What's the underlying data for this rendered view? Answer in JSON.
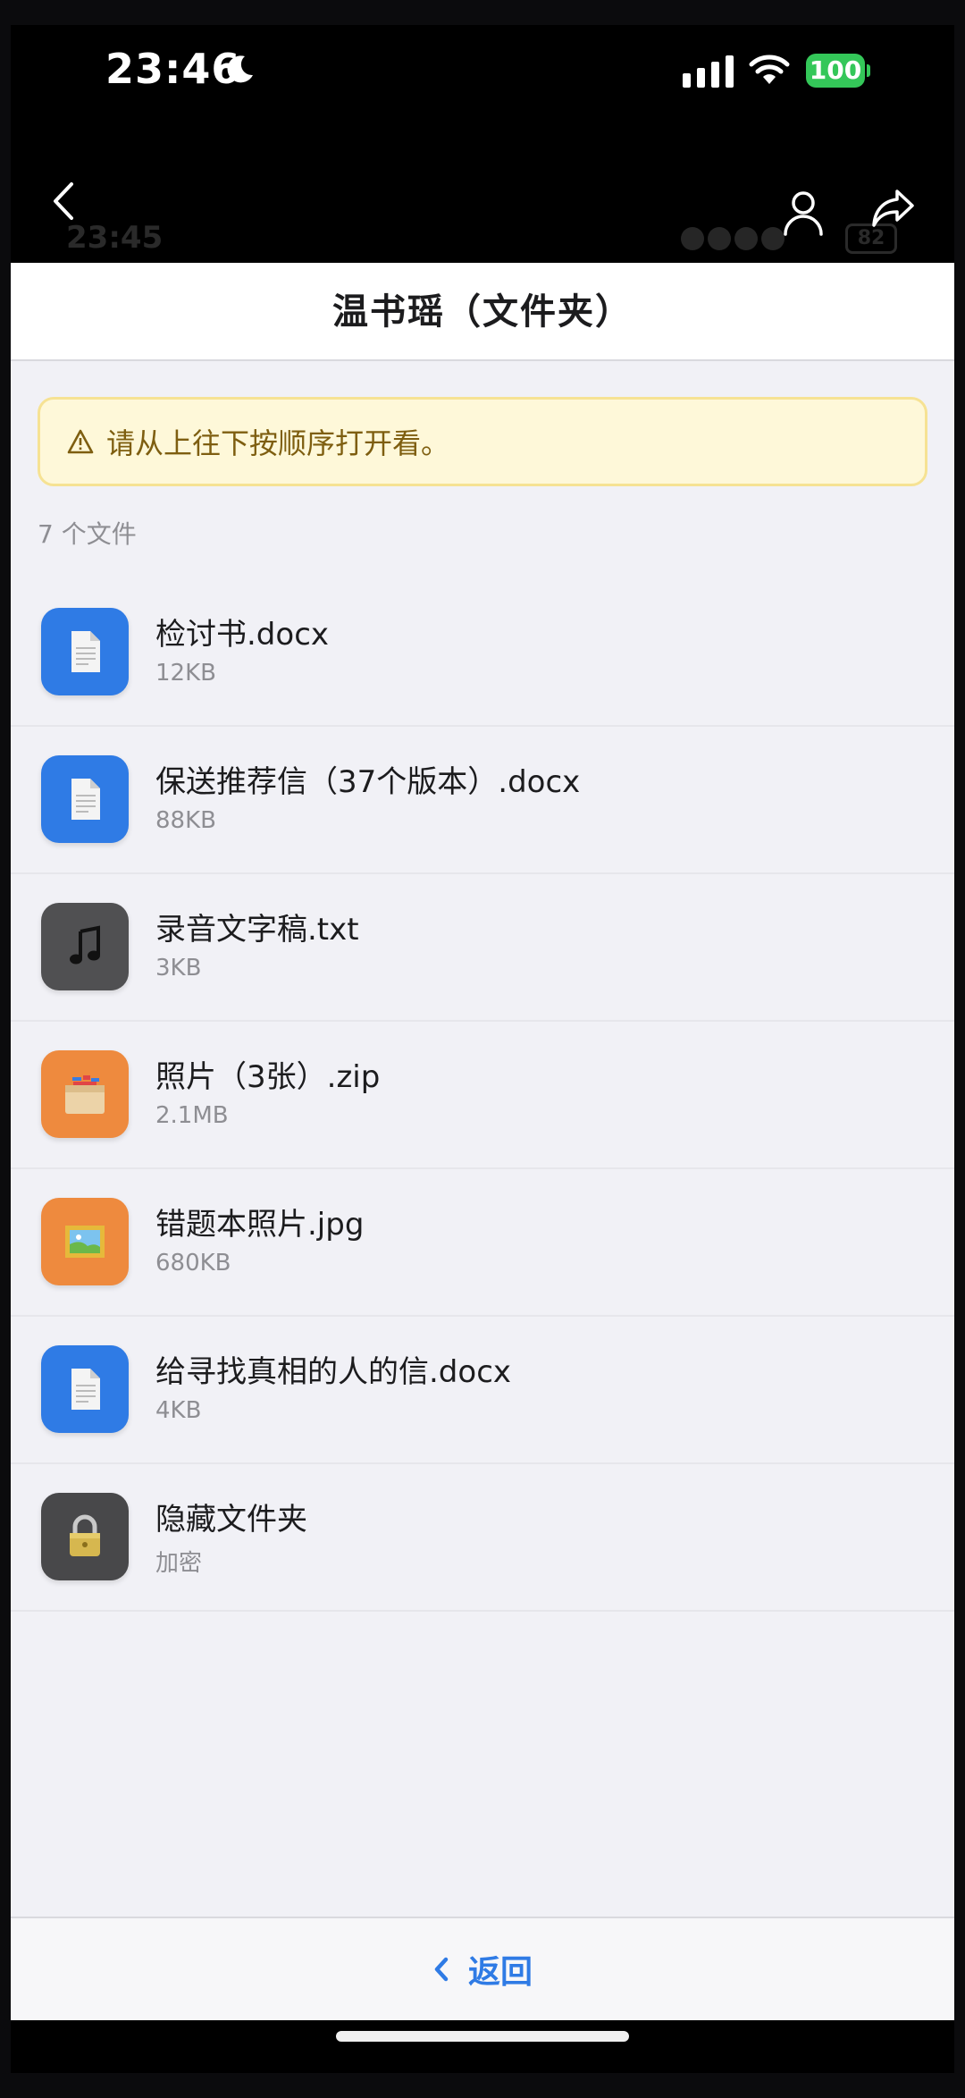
{
  "status_bar": {
    "time": "23:46",
    "battery": "100"
  },
  "ghost_status": {
    "time": "23:45",
    "battery": "82"
  },
  "header": {
    "title": "温书瑶（文件夹）"
  },
  "notice": {
    "text": "请从上往下按顺序打开看。"
  },
  "file_count": "7 个文件",
  "files": [
    {
      "name": "检讨书.docx",
      "meta": "12KB",
      "icon": "document-icon",
      "color": "#2f7be5"
    },
    {
      "name": "保送推荐信（37个版本）.docx",
      "meta": "88KB",
      "icon": "document-icon",
      "color": "#2f7be5"
    },
    {
      "name": "录音文字稿.txt",
      "meta": "3KB",
      "icon": "music-note-icon",
      "color": "#505052"
    },
    {
      "name": "照片（3张）.zip",
      "meta": "2.1MB",
      "icon": "archive-box-icon",
      "color": "#ee8a3e"
    },
    {
      "name": "错题本照片.jpg",
      "meta": "680KB",
      "icon": "framed-picture-icon",
      "color": "#ee8a3e"
    },
    {
      "name": "给寻找真相的人的信.docx",
      "meta": "4KB",
      "icon": "document-icon",
      "color": "#2f7be5"
    },
    {
      "name": "隐藏文件夹",
      "meta": "加密",
      "icon": "lock-icon",
      "color": "#48484a"
    }
  ],
  "bottom": {
    "back_label": "返回"
  },
  "colors": {
    "accent": "#2f7be5",
    "notice_bg": "#fef8d9",
    "notice_text": "#7e5e10"
  }
}
